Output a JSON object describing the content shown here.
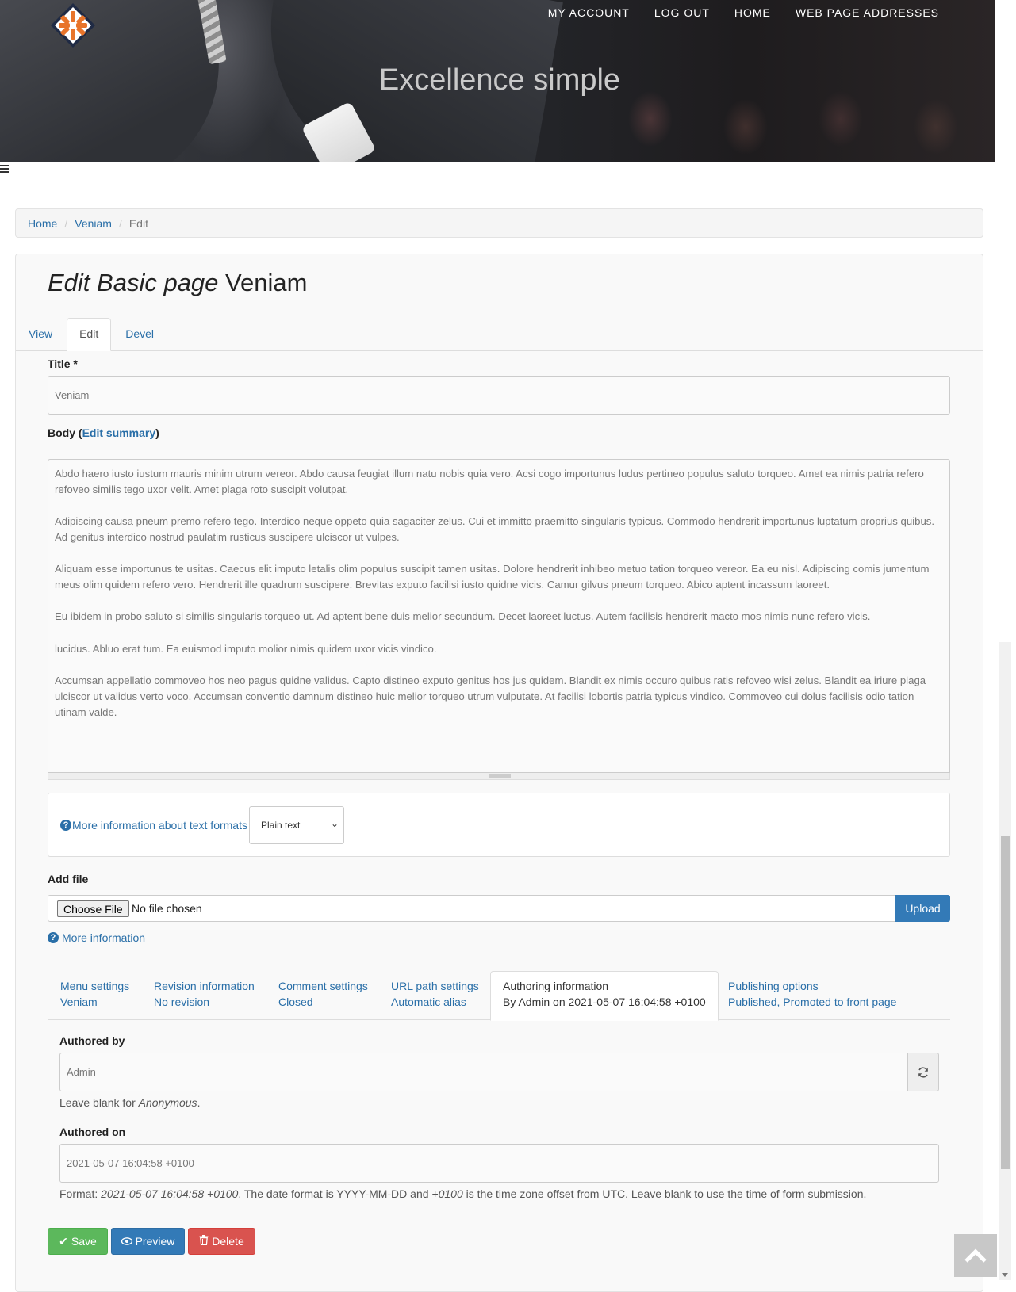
{
  "header": {
    "nav": [
      "MY ACCOUNT",
      "LOG OUT",
      "HOME",
      "WEB PAGE ADDRESSES"
    ],
    "slogan": "Excellence simple"
  },
  "breadcrumb": {
    "items": [
      "Home",
      "Veniam"
    ],
    "current": "Edit"
  },
  "page": {
    "title_italic": "Edit Basic page",
    "title_rest": " Veniam"
  },
  "local_tabs": [
    "View",
    "Edit",
    "Devel"
  ],
  "form": {
    "title_label": "Title *",
    "title_value": "Veniam",
    "body_label": "Body (",
    "body_summary_link": "Edit summary",
    "body_label_end": ")",
    "body_paragraphs": [
      "Abdo haero iusto iustum mauris minim utrum vereor. Abdo causa feugiat illum natu nobis quia vero. Acsi cogo importunus ludus pertineo populus saluto torqueo. Amet ea nimis patria refero refoveo similis tego uxor velit. Amet plaga roto suscipit volutpat.",
      "Adipiscing causa pneum premo refero tego. Interdico neque oppeto quia sagaciter zelus. Cui et immitto praemitto singularis typicus. Commodo hendrerit importunus luptatum proprius quibus. Ad genitus interdico nostrud paulatim rusticus suscipere ulciscor ut vulpes.",
      "Aliquam esse importunus te usitas. Caecus elit imputo letalis olim populus suscipit tamen usitas. Dolore hendrerit inhibeo metuo tation torqueo vereor. Ea eu nisl. Adipiscing comis jumentum meus olim quidem refero vero. Hendrerit ille quadrum suscipere. Brevitas exputo facilisi iusto quidne vicis. Camur gilvus pneum torqueo. Abico aptent incassum laoreet.",
      "Eu ibidem in probo saluto si similis singularis torqueo ut. Ad aptent bene duis melior secundum. Decet laoreet luctus. Autem facilisis hendrerit macto mos nimis nunc refero vicis.",
      "lucidus. Abluo erat tum. Ea euismod imputo molior nimis quidem uxor vicis vindico.",
      "Accumsan appellatio commoveo hos neo pagus quidne validus. Capto distineo exputo genitus hos jus quidem. Blandit ex nimis occuro quibus ratis refoveo wisi zelus. Blandit ea iriure plaga ulciscor ut validus verto voco. Accumsan conventio damnum distineo huic melior torqueo utrum vulputate. At facilisi lobortis patria typicus vindico. Commoveo cui dolus facilisis odio tation utinam valde."
    ],
    "format_help": "More information about text formats",
    "format_selected": "Plain text",
    "add_file_label": "Add file",
    "choose_file": "Choose File",
    "no_file": "No file chosen",
    "upload": "Upload",
    "more_info": "More information"
  },
  "vertical_tabs": [
    {
      "title": "Menu settings",
      "summary": "Veniam"
    },
    {
      "title": "Revision information",
      "summary": "No revision"
    },
    {
      "title": "Comment settings",
      "summary": "Closed"
    },
    {
      "title": "URL path settings",
      "summary": "Automatic alias"
    },
    {
      "title": "Authoring information",
      "summary": "By Admin on 2021-05-07 16:04:58 +0100"
    },
    {
      "title": "Publishing options",
      "summary": "Published, Promoted to front page"
    }
  ],
  "authoring": {
    "authored_by_label": "Authored by",
    "authored_by_value": "Admin",
    "authored_by_help_pre": "Leave blank for ",
    "authored_by_help_em": "Anonymous",
    "authored_by_help_post": ".",
    "authored_on_label": "Authored on",
    "authored_on_value": "2021-05-07 16:04:58 +0100",
    "format_pre": "Format: ",
    "format_em1": "2021-05-07 16:04:58 +0100",
    "format_mid": ". The date format is YYYY-MM-DD and ",
    "format_em2": "+0100",
    "format_post": " is the time zone offset from UTC. Leave blank to use the time of form submission."
  },
  "actions": {
    "save": "Save",
    "preview": "Preview",
    "delete": "Delete"
  },
  "colors": {
    "link": "#2a6fa8",
    "save": "#5cb85c",
    "preview": "#337ab7",
    "delete": "#d9534f"
  }
}
